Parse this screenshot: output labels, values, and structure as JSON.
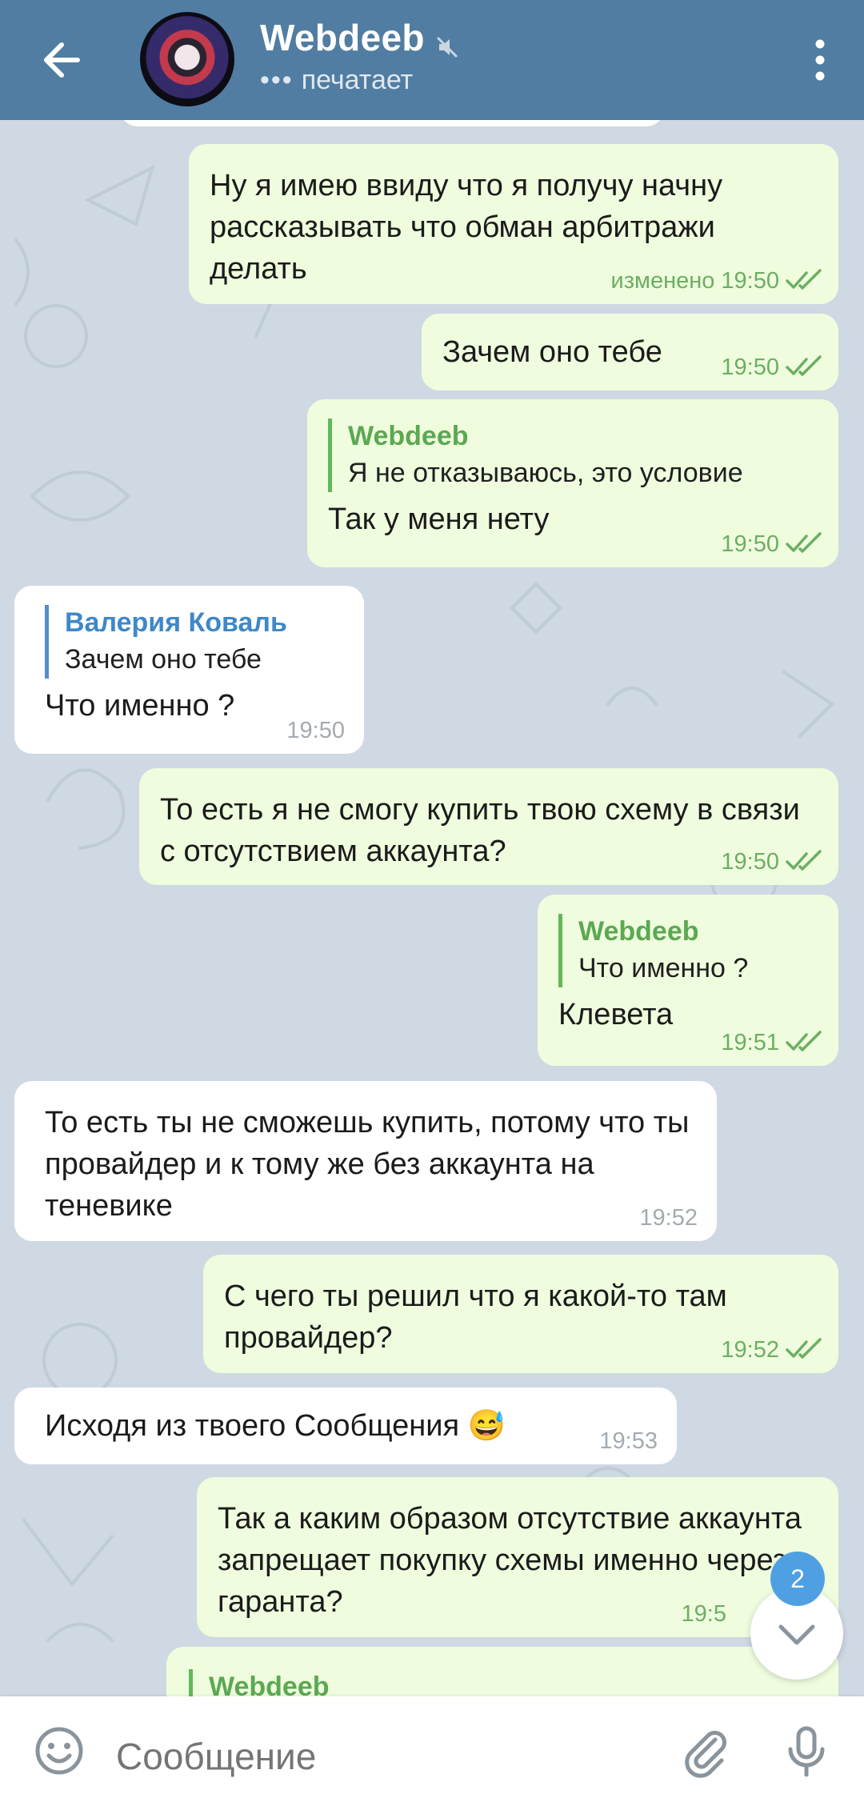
{
  "header": {
    "title": "Webdeeb",
    "status_dots": "•••",
    "status": "печатает"
  },
  "messages": [
    {
      "text": "Ну я имею ввиду что я получу начну рассказывать что обман арбитражи делать",
      "time": "изменено 19:50"
    },
    {
      "text": "Зачем оно тебе",
      "time": "19:50"
    },
    {
      "reply_name": "Webdeeb",
      "reply_text": "Я не отказываюсь,  это условие",
      "text": "Так у меня нету",
      "time": "19:50"
    },
    {
      "reply_name": "Валерия Коваль",
      "reply_text": "Зачем оно тебе",
      "text": "Что именно ?",
      "time": "19:50"
    },
    {
      "text": "То есть я не смогу купить твою схему в связи с отсутствием аккаунта?",
      "time": "19:50"
    },
    {
      "reply_name": "Webdeeb",
      "reply_text": "Что именно ?",
      "text": "Клевета",
      "time": "19:51"
    },
    {
      "text": "То есть ты не сможешь купить, потому что ты провайдер и к тому же без аккаунта на теневике",
      "time": "19:52"
    },
    {
      "text": "С чего ты решил что я какой-то там провайдер?",
      "time": "19:52"
    },
    {
      "text": "Исходя из твоего Сообщения",
      "emoji": "😅",
      "time": "19:53"
    },
    {
      "text": "Так а каким образом отсутствие аккаунта запрещает покупку схемы именно через гаранта?",
      "time": "19:5"
    },
    {
      "reply_name": "Webdeeb"
    }
  ],
  "scroll": {
    "badge": "2"
  },
  "input": {
    "placeholder": "Сообщение"
  },
  "colors": {
    "header": "#517da2",
    "outgoing": "#effdde",
    "incoming": "#ffffff",
    "check": "#6dae63",
    "reply_out": "#5ca853",
    "reply_in": "#3f88c9"
  }
}
